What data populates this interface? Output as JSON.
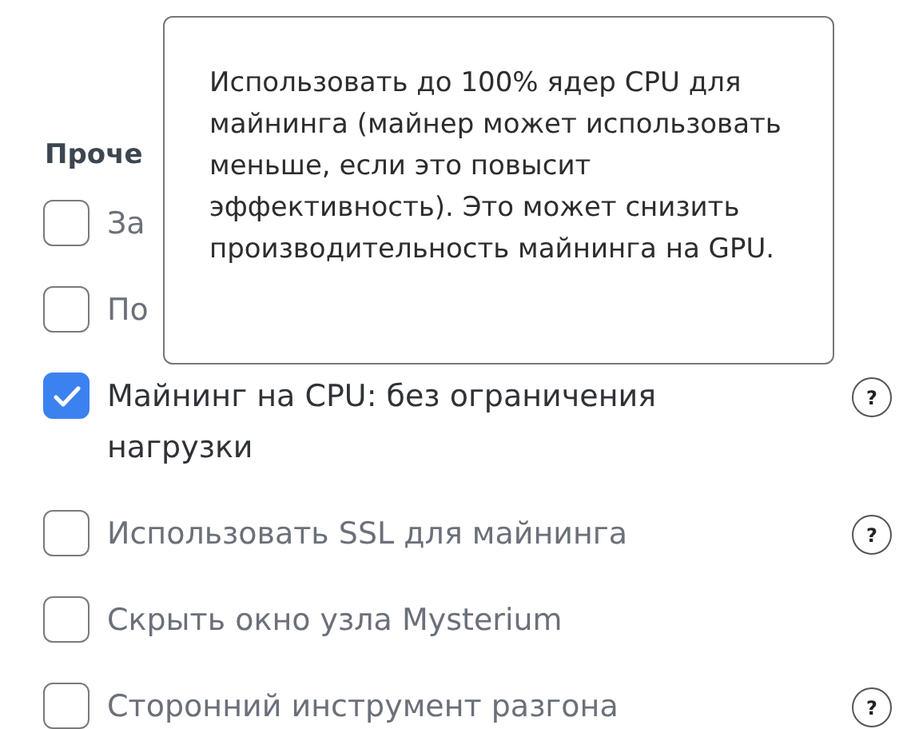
{
  "section": {
    "title": "Проче"
  },
  "options": [
    {
      "label": "За",
      "checked": false
    },
    {
      "label": "По",
      "checked": false
    },
    {
      "label": "Майнинг на CPU: без ограничения нагрузки",
      "checked": true,
      "help": "?"
    },
    {
      "label": "Использовать SSL для майнинга",
      "checked": false,
      "help": "?"
    },
    {
      "label": "Скрыть окно узла Mysterium",
      "checked": false
    },
    {
      "label": "Сторонний инструмент разгона",
      "checked": false,
      "help": "?"
    }
  ],
  "tooltip": {
    "text": "Использовать до 100% ядер CPU для майнинга (майнер может использовать меньше, если это повысит эффективность). Это может снизить производительность майнинга на GPU."
  }
}
